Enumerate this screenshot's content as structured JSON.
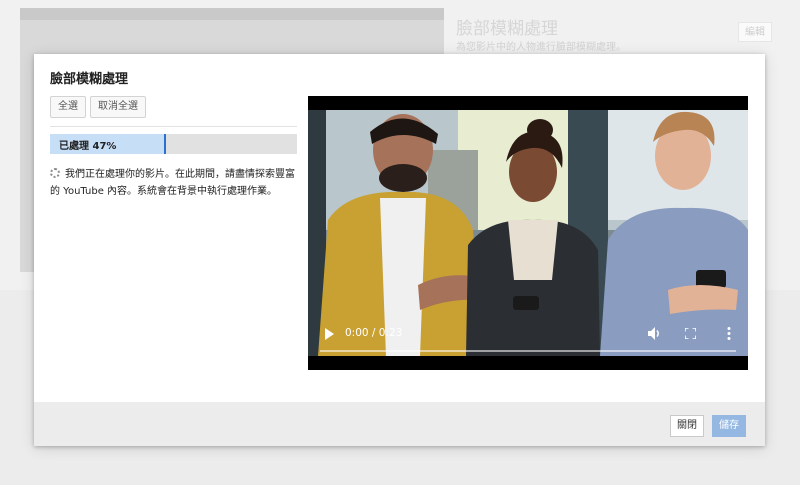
{
  "background": {
    "title": "臉部模糊處理",
    "subtitle": "為您影片中的人物進行臉部模糊處理。",
    "edit_label": "編輯"
  },
  "modal": {
    "title": "臉部模糊處理",
    "select_all": "全選",
    "deselect_all": "取消全選",
    "progress": {
      "label": "已處理 47%",
      "percent": 47
    },
    "status_text": "我們正在處理你的影片。在此期間，請盡情探索豐富的 YouTube 內容。系統會在背景中執行處理作業。",
    "video": {
      "time": "0:00 / 0:23",
      "icons": [
        "play-icon",
        "volume-icon",
        "fullscreen-icon",
        "more-vert-icon"
      ]
    },
    "footer": {
      "close_label": "關閉",
      "save_label": "儲存"
    }
  },
  "colors": {
    "progress_fill": "#c7def7",
    "progress_marker": "#2b6fd0",
    "save_button": "#95b8e3"
  }
}
